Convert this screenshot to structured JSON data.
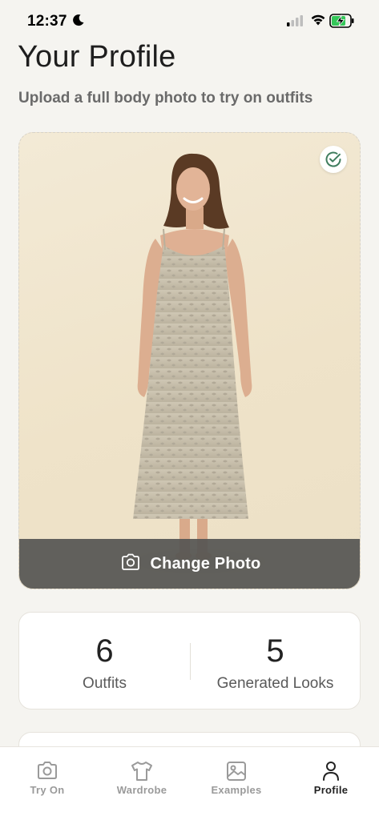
{
  "status_bar": {
    "time": "12:37",
    "icons": [
      "moon-icon",
      "cellular-signal-icon",
      "wifi-icon",
      "battery-charging-icon"
    ],
    "battery_color": "#34c759"
  },
  "header": {
    "title": "Your Profile",
    "subtitle": "Upload a full body photo to try on outfits"
  },
  "photo_card": {
    "badge_icon": "check-circle-icon",
    "badge_color": "#3f7d5e",
    "change_photo_icon": "camera-icon",
    "change_photo_label": "Change Photo"
  },
  "stats": [
    {
      "value": "6",
      "label": "Outfits"
    },
    {
      "value": "5",
      "label": "Generated Looks"
    }
  ],
  "tabs": [
    {
      "label": "Try On",
      "icon": "camera-icon",
      "active": false
    },
    {
      "label": "Wardrobe",
      "icon": "shirt-icon",
      "active": false
    },
    {
      "label": "Examples",
      "icon": "image-icon",
      "active": false
    },
    {
      "label": "Profile",
      "icon": "person-icon",
      "active": true
    }
  ],
  "colors": {
    "background": "#f5f4f0",
    "card": "#ffffff",
    "overlay": "#555552",
    "tab_active": "#222222",
    "tab_inactive": "#9a9a9a"
  }
}
